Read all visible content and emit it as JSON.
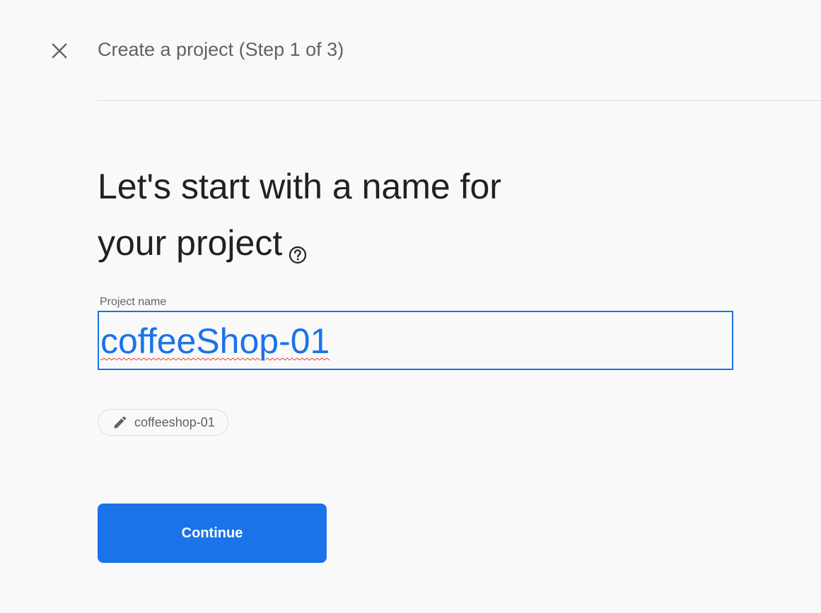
{
  "header": {
    "title": "Create a project (Step 1 of 3)",
    "close_icon": "close-icon"
  },
  "main": {
    "headline_line1": "Let's start with a name for",
    "headline_line2": "your project",
    "help_icon": "help-circle-icon",
    "field": {
      "label": "Project name",
      "value": "coffeeShop-01"
    },
    "project_id_chip": {
      "icon": "pencil-icon",
      "text": "coffeeshop-01"
    },
    "continue_label": "Continue"
  },
  "colors": {
    "accent": "#1a73e8",
    "background": "#f9f9f9",
    "text_primary": "#202124",
    "text_secondary": "#5f6368",
    "divider": "#dadce0",
    "spellcheck": "#e53935"
  }
}
